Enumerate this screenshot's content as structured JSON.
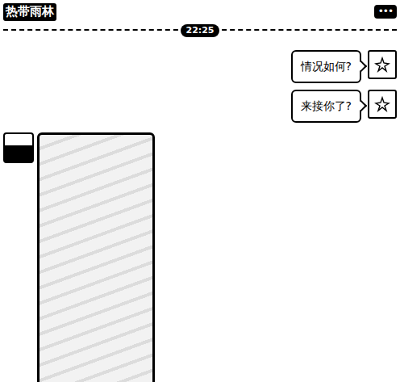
{
  "title": "热带雨林",
  "menu": "•••",
  "time": "22:25",
  "messages": [
    {
      "kind": "text",
      "outgoing": true,
      "text": "情况如何?"
    },
    {
      "kind": "text",
      "outgoing": true,
      "text": "来接你了?"
    },
    {
      "kind": "media",
      "outgoing": false
    }
  ]
}
